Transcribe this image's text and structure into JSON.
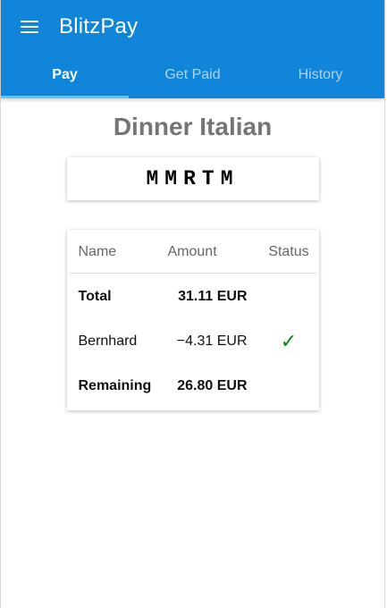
{
  "app": {
    "title": "BlitzPay"
  },
  "icons": {
    "menu": "menu-icon",
    "status": "check-icon"
  },
  "colors": {
    "primary": "#1085d9",
    "tab_indicator": "#5ec5ff",
    "success": "#0a8a0a"
  },
  "tabs": [
    {
      "label": "Pay",
      "active": true
    },
    {
      "label": "Get Paid",
      "active": false
    },
    {
      "label": "History",
      "active": false
    }
  ],
  "bill": {
    "title": "Dinner Italian",
    "code": "MMRTM"
  },
  "table": {
    "headers": {
      "name": "Name",
      "amount": "Amount",
      "status": "Status"
    },
    "rows": [
      {
        "name": "Total",
        "amount": "31.11 EUR",
        "status": ""
      },
      {
        "name": "Bernhard",
        "amount": "−4.31 EUR",
        "status": "✓"
      },
      {
        "name": "Remaining",
        "amount": "26.80 EUR",
        "status": ""
      }
    ]
  }
}
